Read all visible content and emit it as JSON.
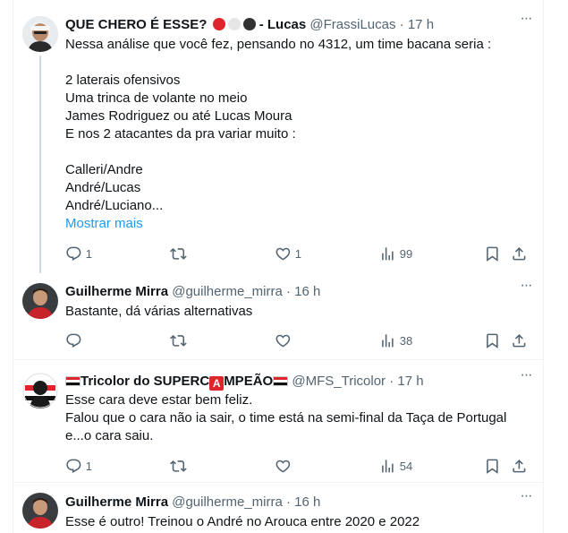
{
  "tweets": [
    {
      "name": "QUE CHERO É ESSE?",
      "name_suffix": "- Lucas",
      "handle": "@FrassiLucas",
      "dot": "·",
      "time": "17 h",
      "text": "Nessa análise que você fez, pensando no 4312, um time bacana seria :\n\n2 laterais ofensivos\nUma trinca de volante no meio\nJames Rodriguez ou até Lucas Moura\nE nos 2 atacantes da pra variar muito :\n\nCalleri/Andre\nAndré/Lucas\nAndré/Luciano...",
      "show_more": "Mostrar mais",
      "replies": "1",
      "retweets": "",
      "likes": "1",
      "views": "99"
    },
    {
      "name": "Guilherme Mirra",
      "handle": "@guilherme_mirra",
      "dot": "·",
      "time": "16 h",
      "text": "Bastante, dá várias alternativas",
      "replies": "",
      "retweets": "",
      "likes": "",
      "views": "38"
    },
    {
      "name_prefix": "Tricolor do SUPERC",
      "name_a": "A",
      "name_suffix": "MPEÃO",
      "handle": "@MFS_Tricolor",
      "dot": "·",
      "time": "17 h",
      "text": "Esse cara deve estar bem feliz.\nFalou que o cara não ia sair, o time está na semi-final da Taça de Portugal\ne...o cara saiu.",
      "replies": "1",
      "retweets": "",
      "likes": "",
      "views": "54"
    },
    {
      "name": "Guilherme Mirra",
      "handle": "@guilherme_mirra",
      "dot": "·",
      "time": "16 h",
      "text": "Esse é outro! Treinou o André no Arouca entre 2020 e 2022"
    }
  ],
  "icons": {
    "more": "more-icon",
    "reply": "reply-icon",
    "retweet": "retweet-icon",
    "like": "heart-icon",
    "views": "views-icon",
    "bookmark": "bookmark-icon",
    "share": "share-icon"
  },
  "colors": {
    "text": "#0f1419",
    "secondary": "#536471",
    "link": "#1d9bf0",
    "divider": "#eff3f4",
    "thread_line": "#cfd9de",
    "badge_red": "#e0242b"
  }
}
